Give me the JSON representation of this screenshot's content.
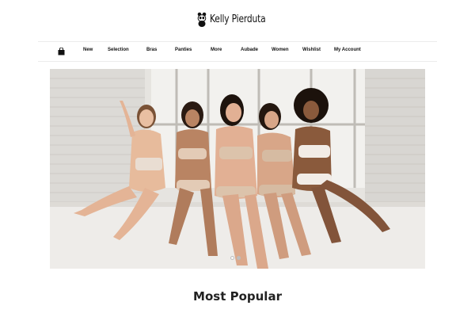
{
  "brand": {
    "name": "Kelly Pierduta",
    "logo_icon": "panda-icon"
  },
  "nav": {
    "cart_icon": "shopping-bag-icon",
    "items": [
      "New",
      "Selection",
      "Bras",
      "Panties",
      "More",
      "Aubade",
      "Women",
      "Wishlist",
      "My Account"
    ]
  },
  "slider": {
    "slide_count": 2,
    "active_slide": 1
  },
  "section": {
    "title": "Most Popular"
  }
}
